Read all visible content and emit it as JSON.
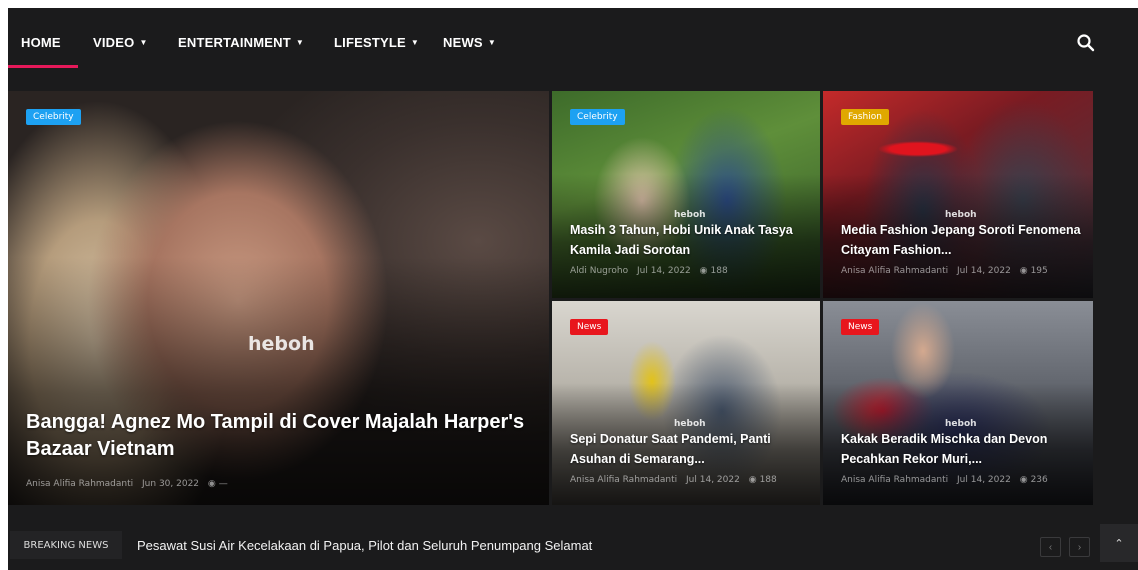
{
  "nav": {
    "items": [
      {
        "label": "HOME",
        "dropdown": false,
        "active": true
      },
      {
        "label": "VIDEO",
        "dropdown": true,
        "active": false
      },
      {
        "label": "ENTERTAINMENT",
        "dropdown": true,
        "active": false
      },
      {
        "label": "LIFESTYLE",
        "dropdown": true,
        "active": false
      },
      {
        "label": "NEWS",
        "dropdown": true,
        "active": false
      }
    ],
    "caret": "▼",
    "search_icon": "search-icon"
  },
  "accent_color": "#e6195a",
  "watermark": "heboh",
  "articles": [
    {
      "badge": "Celebrity",
      "badge_color": "#1da1f2",
      "title": "Bangga! Agnez Mo Tampil di Cover Majalah Harper's Bazaar Vietnam",
      "author": "Anisa Alifia Rahmadanti",
      "date": "Jun 30, 2022",
      "views": "—"
    },
    {
      "badge": "Celebrity",
      "badge_color": "#1da1f2",
      "title": "Masih 3 Tahun, Hobi Unik Anak Tasya Kamila Jadi Sorotan",
      "author": "Aldi Nugroho",
      "date": "Jul 14, 2022",
      "views": "188"
    },
    {
      "badge": "Fashion",
      "badge_color": "#e0a800",
      "title": "Media Fashion Jepang Soroti Fenomena Citayam Fashion...",
      "author": "Anisa Alifia Rahmadanti",
      "date": "Jul 14, 2022",
      "views": "195"
    },
    {
      "badge": "News",
      "badge_color": "#e8161d",
      "title": "Sepi Donatur Saat Pandemi, Panti Asuhan di Semarang...",
      "author": "Anisa Alifia Rahmadanti",
      "date": "Jul 14, 2022",
      "views": "188"
    },
    {
      "badge": "News",
      "badge_color": "#e8161d",
      "title": "Kakak Beradik Mischka dan Devon Pecahkan Rekor Muri,...",
      "author": "Anisa Alifia Rahmadanti",
      "date": "Jul 14, 2022",
      "views": "236"
    }
  ],
  "breaking": {
    "label": "BREAKING NEWS",
    "headline": "Pesawat Susi Air Kecelakaan di Papua, Pilot dan Seluruh Penumpang Selamat",
    "prev": "‹",
    "next": "›",
    "top": "⌃"
  }
}
